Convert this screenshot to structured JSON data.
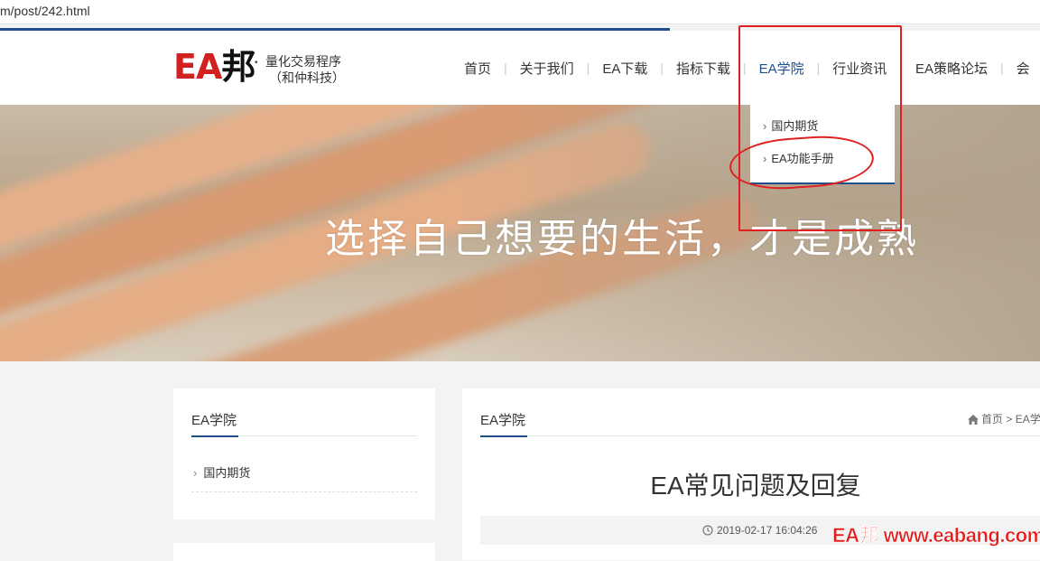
{
  "browser": {
    "url": "m/post/242.html"
  },
  "logo": {
    "mark": "EA邦",
    "tagline_line1": "量化交易程序",
    "tagline_line2": "（和仲科技）"
  },
  "nav": {
    "items": [
      {
        "label": "首页"
      },
      {
        "label": "关于我们"
      },
      {
        "label": "EA下载"
      },
      {
        "label": "指标下载"
      },
      {
        "label": "EA学院"
      },
      {
        "label": "行业资讯"
      },
      {
        "label": "EA策略论坛"
      },
      {
        "label": "会"
      }
    ],
    "active": "EA学院"
  },
  "dropdown": {
    "items": [
      {
        "label": "国内期货"
      },
      {
        "label": "EA功能手册"
      }
    ]
  },
  "banner": {
    "slogan": "选择自己想要的生活，才是成熟"
  },
  "sidebar": {
    "title": "EA学院",
    "categories": [
      {
        "label": "国内期货"
      }
    ]
  },
  "main": {
    "section_title": "EA学院",
    "breadcrumb": {
      "home": "首页",
      "sep": ">",
      "current": "EA学"
    },
    "post_title": "EA常见问题及回复",
    "post_time": "2019-02-17 16:04:26"
  },
  "watermark": "EA邦 www.eabang.com",
  "colors": {
    "accent": "#1f4e8c",
    "annotation": "#e02020"
  },
  "icons": {
    "home": "home-icon",
    "clock": "clock-icon",
    "chevron": "chevron-right-icon"
  }
}
